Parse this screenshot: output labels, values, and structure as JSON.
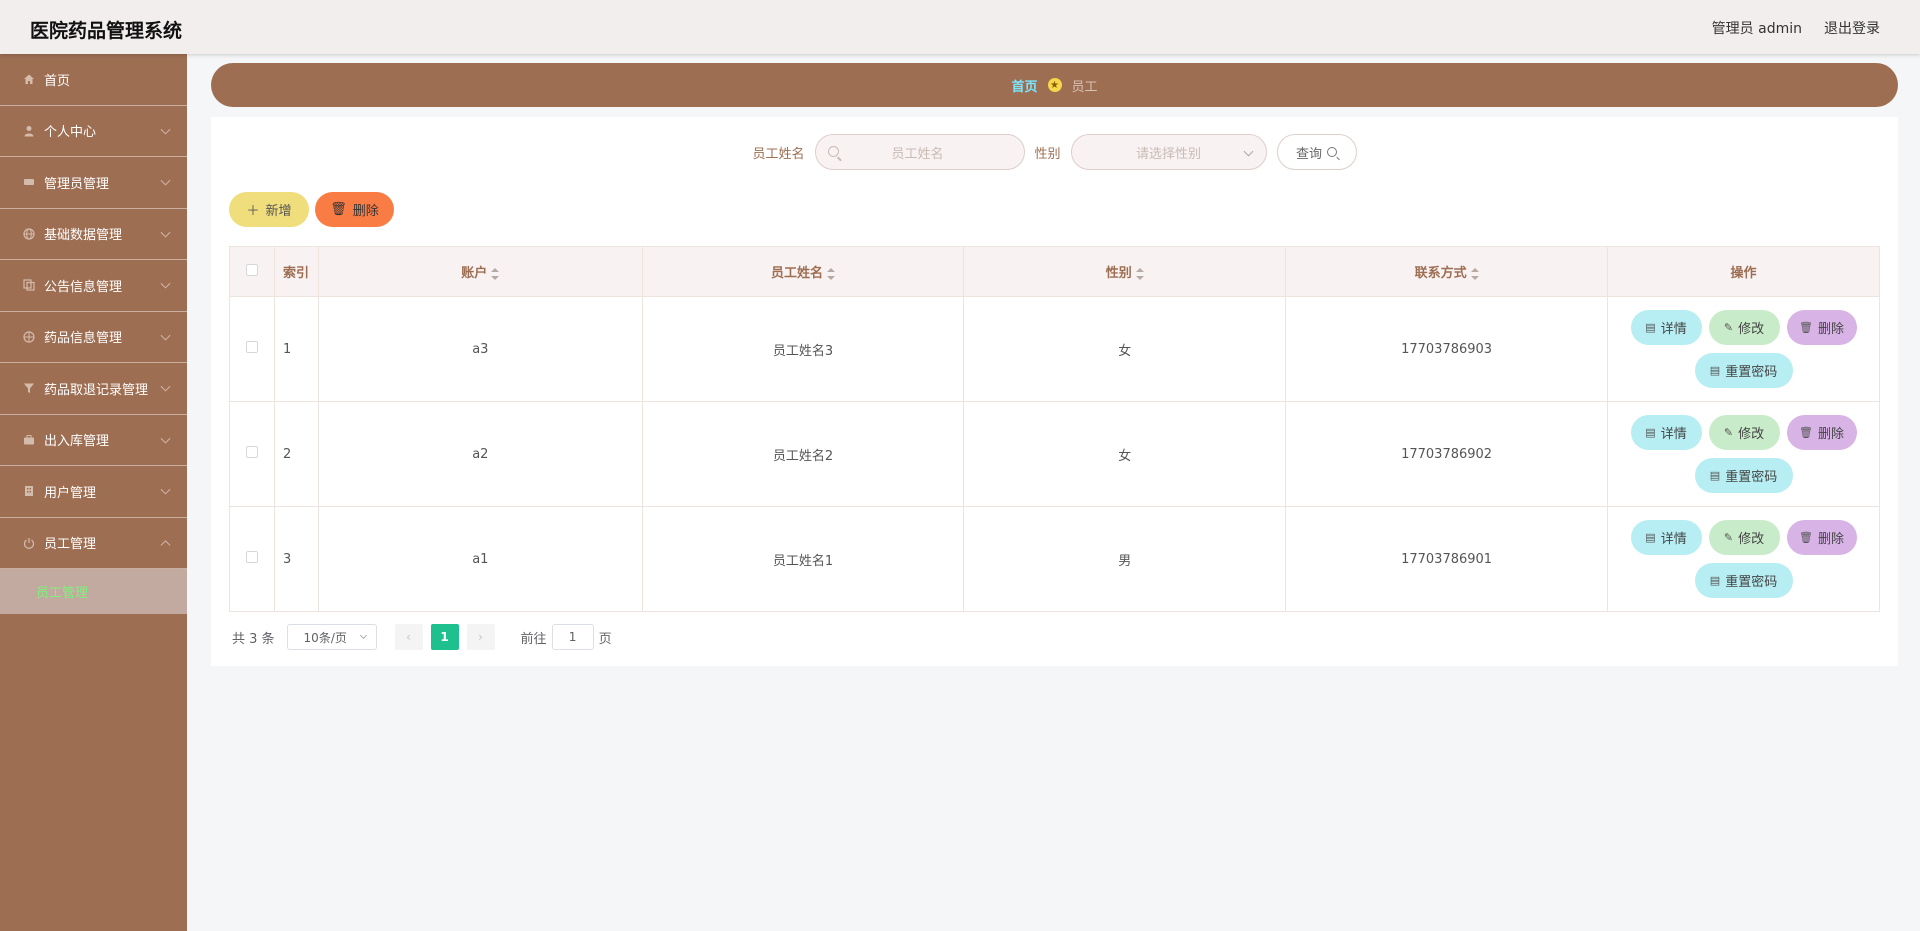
{
  "header": {
    "title": "医院药品管理系统",
    "user_label": "管理员 admin",
    "logout_label": "退出登录"
  },
  "sidebar": {
    "items": [
      {
        "label": "首页",
        "icon": "home-icon"
      },
      {
        "label": "个人中心",
        "icon": "user-icon"
      },
      {
        "label": "管理员管理",
        "icon": "admin-icon"
      },
      {
        "label": "基础数据管理",
        "icon": "globe-icon"
      },
      {
        "label": "公告信息管理",
        "icon": "copy-icon"
      },
      {
        "label": "药品信息管理",
        "icon": "globe-icon"
      },
      {
        "label": "药品取退记录管理",
        "icon": "filter-icon"
      },
      {
        "label": "出入库管理",
        "icon": "briefcase-icon"
      },
      {
        "label": "用户管理",
        "icon": "building-icon"
      },
      {
        "label": "员工管理",
        "icon": "power-icon"
      }
    ],
    "active_sub_item": "员工管理"
  },
  "breadcrumb": {
    "home": "首页",
    "current": "员工"
  },
  "search": {
    "name_label": "员工姓名",
    "name_placeholder": "员工姓名",
    "gender_label": "性别",
    "gender_placeholder": "请选择性别",
    "query_label": "查询"
  },
  "actions": {
    "add_label": "新增",
    "delete_label": "删除"
  },
  "table": {
    "headers": {
      "index": "索引",
      "account": "账户",
      "name": "员工姓名",
      "gender": "性别",
      "phone": "联系方式",
      "ops": "操作"
    },
    "rows": [
      {
        "index": "1",
        "account": "a3",
        "name": "员工姓名3",
        "gender": "女",
        "phone": "17703786903"
      },
      {
        "index": "2",
        "account": "a2",
        "name": "员工姓名2",
        "gender": "女",
        "phone": "17703786902"
      },
      {
        "index": "3",
        "account": "a1",
        "name": "员工姓名1",
        "gender": "男",
        "phone": "17703786901"
      }
    ],
    "op_labels": {
      "detail": "详情",
      "edit": "修改",
      "delete": "删除",
      "reset": "重置密码"
    }
  },
  "pagination": {
    "total_text": "共 3 条",
    "page_size": "10条/页",
    "current_page": "1",
    "goto_label": "前往",
    "goto_value": "1",
    "page_suffix": "页"
  },
  "colors": {
    "brand": "#9e6e53",
    "active_page": "#1ec08e",
    "add_button": "#f0de7c",
    "delete_button": "#fa7c45"
  }
}
